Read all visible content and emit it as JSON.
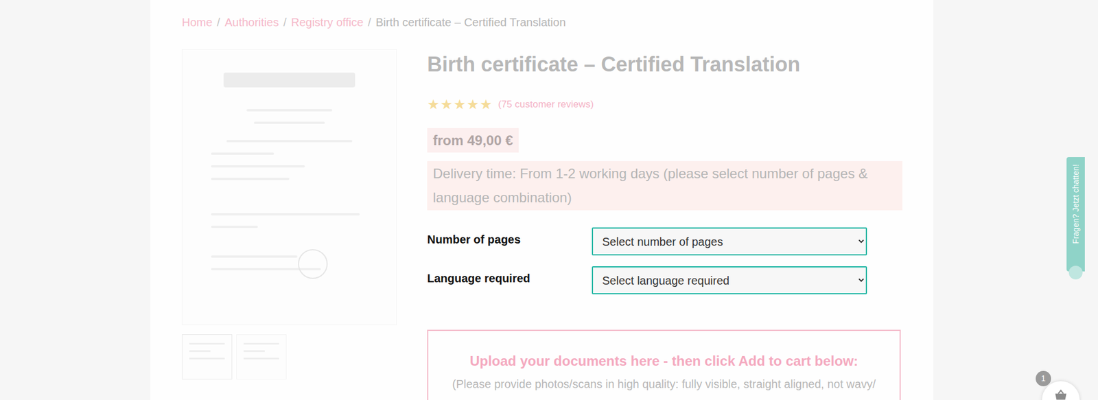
{
  "breadcrumb": {
    "separator": "/",
    "items": [
      {
        "label": "Home",
        "link": true
      },
      {
        "label": "Authorities",
        "link": true
      },
      {
        "label": "Registry office",
        "link": true
      },
      {
        "label": "Birth certificate – Certified Translation",
        "link": false
      }
    ]
  },
  "gallery": {
    "thumbnails": [
      {
        "selected": true
      },
      {
        "selected": false
      }
    ]
  },
  "product": {
    "title": "Birth certificate – Certified Translation",
    "stars": 5,
    "star_glyph": "★",
    "reviews": "(75 customer reviews)",
    "price": "from 49,00 €",
    "delivery": "Delivery time: From 1-2 working days (please select number of pages & language combination)"
  },
  "options": [
    {
      "label": "Number of pages",
      "placeholder": "Select number of pages"
    },
    {
      "label": "Language required",
      "placeholder": "Select language required"
    }
  ],
  "upload": {
    "heading": "Upload your documents here - then click Add to cart below:",
    "note": "(Please provide photos/scans in high quality: fully visible, straight aligned, not wavy/"
  },
  "chat": {
    "label": "Fragen? Jetzt chatten!"
  },
  "cart": {
    "count": "1"
  }
}
